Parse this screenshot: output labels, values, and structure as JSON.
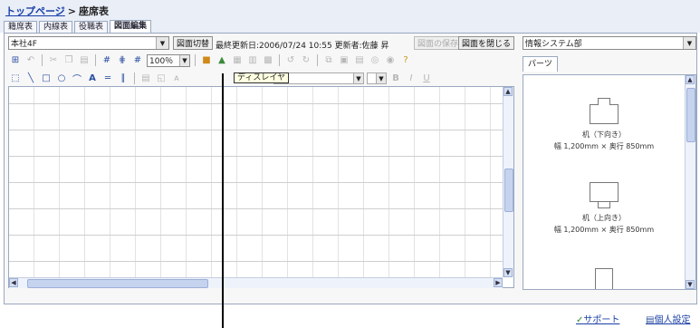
{
  "breadcrumb": {
    "top": "トップページ",
    "sep": ">",
    "current": "座席表"
  },
  "tabs": [
    {
      "label": "籍席表",
      "active": false
    },
    {
      "label": "内線表",
      "active": false
    },
    {
      "label": "役職表",
      "active": false
    },
    {
      "label": "図面編集",
      "active": true
    }
  ],
  "floor_select": {
    "value": "本社4F"
  },
  "buttons": {
    "switch_drawing": "図面切替",
    "save_drawing": "図面の保存",
    "close_drawing": "図面を閉じる"
  },
  "last_updated": {
    "label": "最終更新日:",
    "value": "2006/07/24 10:55",
    "editor_label": "更新者:",
    "editor": "佐藤 昇"
  },
  "zoom": {
    "value": "100％"
  },
  "tooltip": "ディスレイヤ",
  "department_select": {
    "value": "情報システム部"
  },
  "parts": {
    "tab_label": "パーツ",
    "items": [
      {
        "name": "机（下向き）",
        "size": "幅 1,200mm × 奥行 850mm"
      },
      {
        "name": "机（上向き）",
        "size": "幅 1,200mm × 奥行 850mm"
      }
    ]
  },
  "footer": {
    "support": "サポート",
    "personal": "個人設定"
  },
  "toolbar_icons": {
    "row1": [
      "insert-table-icon",
      "undo-icon",
      "cut-icon",
      "copy-icon",
      "paste-icon",
      "grid-icon",
      "grid-snap-icon",
      "grid-toggle-icon",
      "layer-show-icon",
      "layer-hide-icon",
      "group-icon",
      "align-icon",
      "distribute-icon",
      "rotate-left-icon",
      "rotate-right-icon",
      "bring-front-icon",
      "send-back-icon",
      "order-icon",
      "lock-icon",
      "unlock-icon",
      "help-icon"
    ],
    "row2": [
      "select-tool-icon",
      "line-tool-icon",
      "rect-tool-icon",
      "ellipse-tool-icon",
      "polyline-tool-icon",
      "text-tool-icon",
      "double-line-icon",
      "column-icon",
      "fill-color-icon",
      "line-color-icon",
      "font-color-icon",
      "text-align-icon",
      "text-valign-icon",
      "bold-icon",
      "italic-icon",
      "underline-icon"
    ]
  },
  "colors": {
    "link": "#1a3fa6",
    "header_band": "#e9eef7",
    "frame_border": "#9aa8bf",
    "tooltip_bg": "#ffffe1"
  }
}
